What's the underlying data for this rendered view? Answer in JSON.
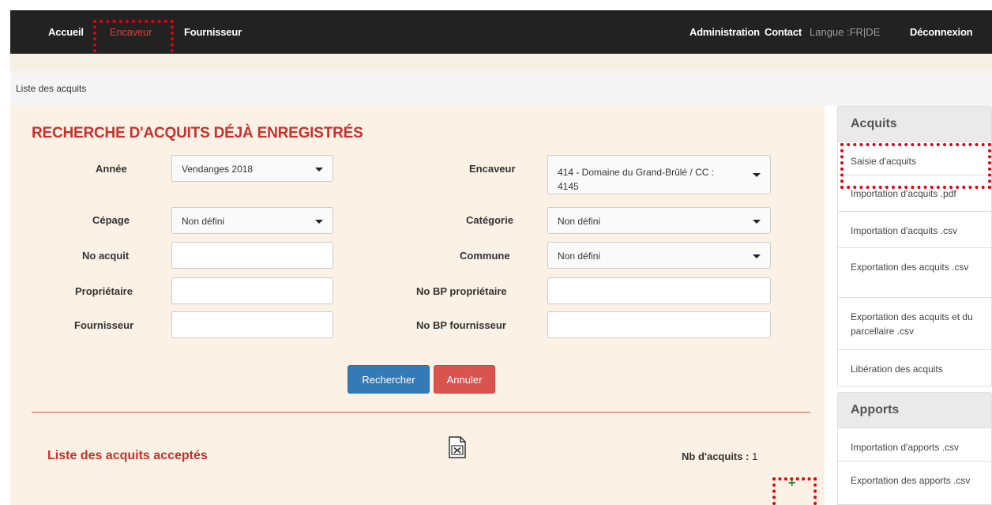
{
  "nav": {
    "home": "Accueil",
    "encaveur": "Encaveur",
    "fournisseur": "Fournisseur",
    "administration": "Administration",
    "contact": "Contact",
    "langue": "Langue :FR|DE",
    "logout": "Déconnexion"
  },
  "breadcrumb": "Liste des acquits",
  "page_title": "RECHERCHE D'ACQUITS DÉJÀ ENREGISTRÉS",
  "form": {
    "annee_label": "Année",
    "annee_value": "Vendanges 2018",
    "encaveur_label": "Encaveur",
    "encaveur_value": "414 - Domaine du Grand-Brûlé / CC : 4145",
    "cepage_label": "Cépage",
    "cepage_value": "Non défini",
    "categorie_label": "Catégorie",
    "categorie_value": "Non défini",
    "no_acquit_label": "No acquit",
    "commune_label": "Commune",
    "commune_value": "Non défini",
    "proprietaire_label": "Propriétaire",
    "no_bp_proprietaire_label": "No BP propriétaire",
    "fournisseur_label": "Fournisseur",
    "no_bp_fournisseur_label": "No BP fournisseur",
    "search_button": "Rechercher",
    "cancel_button": "Annuler"
  },
  "list": {
    "title": "Liste des acquits acceptés",
    "count_label": "Nb d'acquits :",
    "count_value": "1"
  },
  "sidebar": {
    "acquits_header": "Acquits",
    "acquits_items": [
      "Saisie d'acquits",
      "Importation d'acquits .pdf",
      "Importation d'acquits .csv",
      "Exportation des acquits .csv",
      "Exportation des acquits et du parcellaire .csv",
      "Libération des acquits"
    ],
    "apports_header": "Apports",
    "apports_items": [
      "Importation d'apports .csv",
      "Exportation des apports .csv"
    ]
  },
  "colors": {
    "navbar": "#222222",
    "accent_red": "#c9302c",
    "primary": "#337ab7",
    "danger": "#d9534f",
    "highlight": "#e3000f",
    "add_icon": "#2e8b2e"
  },
  "icons": {
    "excel_export": "excel-file-icon",
    "add": "plus-icon"
  }
}
